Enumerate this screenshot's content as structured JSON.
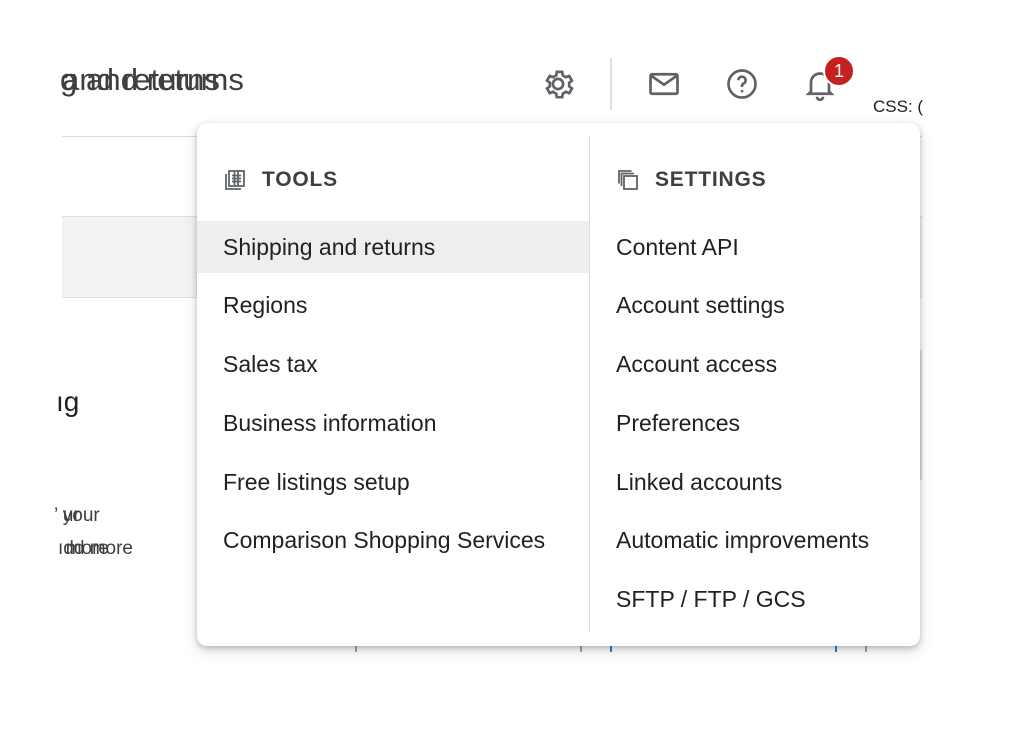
{
  "header": {
    "page_title": "g and returns",
    "css_label": "CSS: (",
    "notification_count": "1"
  },
  "background": {
    "section_heading": "ıg",
    "text_line_1": "’ your",
    "text_line_2": "ıdd more"
  },
  "icons": {
    "settings": "gear-icon",
    "mail": "mail-icon",
    "help": "help-icon",
    "notifications": "bell-icon"
  },
  "menu": {
    "tools": {
      "title": "TOOLS",
      "icon": "tools-icon",
      "items": [
        {
          "label": "Shipping and returns",
          "selected": true
        },
        {
          "label": "Regions"
        },
        {
          "label": "Sales tax"
        },
        {
          "label": "Business information"
        },
        {
          "label": "Free listings setup"
        },
        {
          "label": "Comparison Shopping Services"
        }
      ]
    },
    "settings": {
      "title": "SETTINGS",
      "icon": "settings-copy-icon",
      "items": [
        {
          "label": "Content API"
        },
        {
          "label": "Account settings"
        },
        {
          "label": "Account access"
        },
        {
          "label": "Preferences"
        },
        {
          "label": "Linked accounts"
        },
        {
          "label": "Automatic improvements"
        },
        {
          "label": "SFTP / FTP / GCS"
        }
      ]
    }
  },
  "colors": {
    "badge": "#c5221f",
    "selected_bg": "#eeeeee",
    "icon_grey": "#5f6368",
    "divider": "#dadce0"
  }
}
